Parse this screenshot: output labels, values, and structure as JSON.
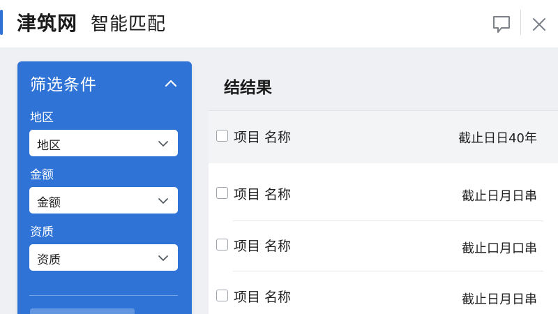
{
  "titlebar": {
    "brand": "津筑网",
    "subtitle": "智能匹配",
    "feedback_icon": "feedback-icon",
    "close_icon": "close-icon"
  },
  "filter": {
    "title": "筛选条件",
    "fields": [
      {
        "label": "地区",
        "value": "地区"
      },
      {
        "label": "金额",
        "value": "金额"
      },
      {
        "label": "资质",
        "value": "资质"
      }
    ]
  },
  "results": {
    "title": "结结果",
    "header": {
      "name": "项目 名称",
      "date": "截止日日40年"
    },
    "rows": [
      {
        "name": "项目 名称",
        "date": "截止日月日串"
      },
      {
        "name": "项目 名称",
        "date": "截止口月口串"
      },
      {
        "name": "项目 名称",
        "date": "截止日月日串"
      }
    ]
  },
  "colors": {
    "accent": "#2f73d6",
    "panel_bg": "#eef0f3",
    "header_row_bg": "#f2f4f6"
  }
}
